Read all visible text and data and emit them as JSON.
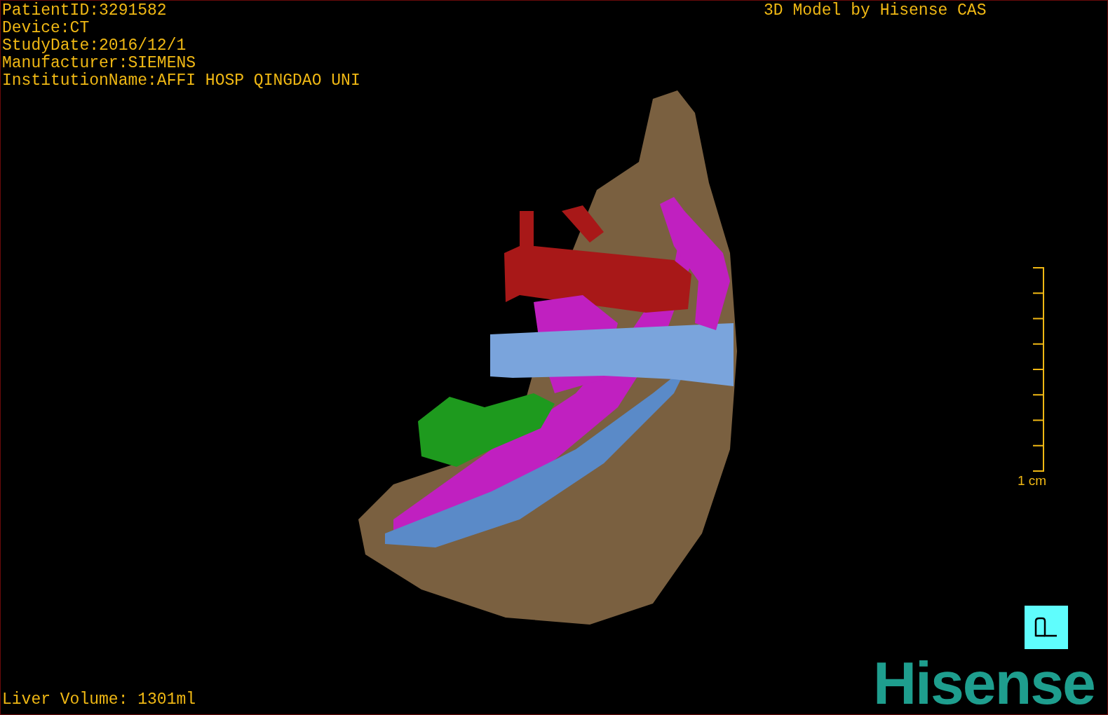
{
  "patient_info": [
    "PatientID:3291582",
    "Device:CT",
    "StudyDate:2016/12/1",
    "Manufacturer:SIEMENS",
    "InstitutionName:AFFI HOSP QINGDAO UNI"
  ],
  "header": "3D Model by Hisense CAS",
  "scale_bar": {
    "label": "1 cm"
  },
  "liver_volume": "Liver Volume: 1301ml",
  "logo": "Hisense"
}
